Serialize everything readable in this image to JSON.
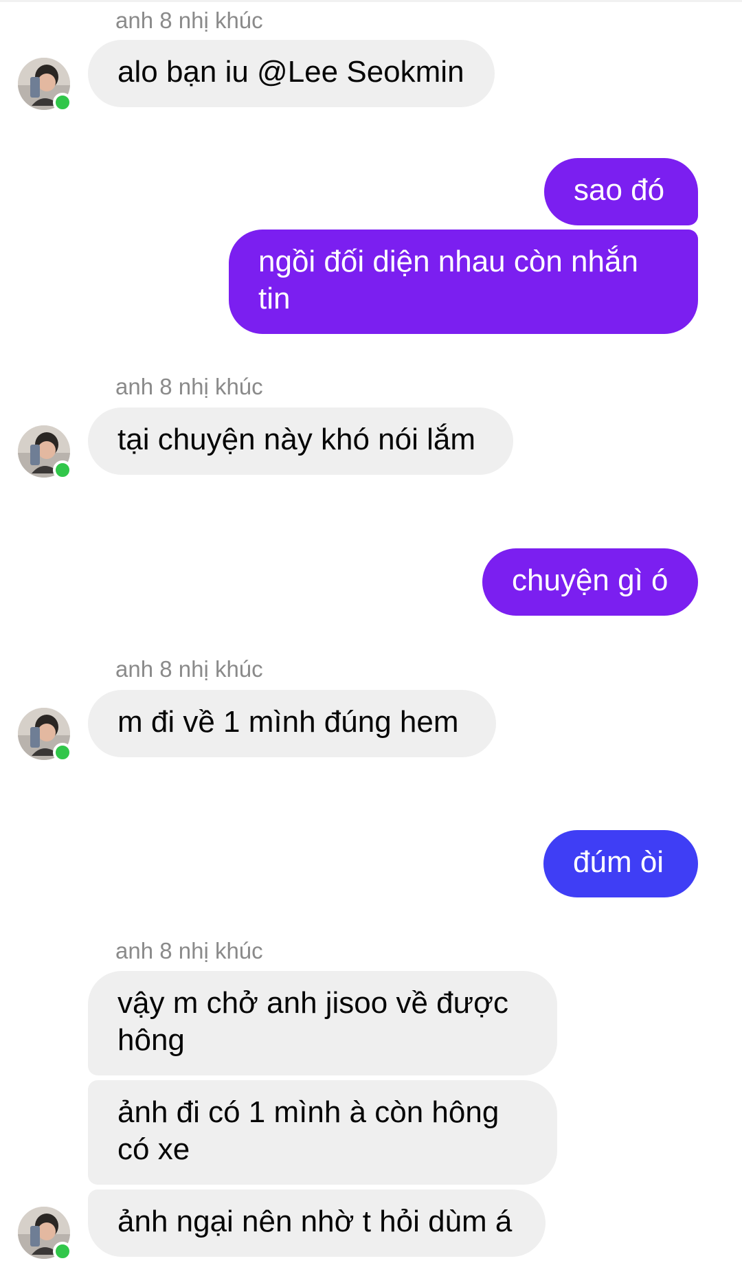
{
  "sender_name": "anh 8 nhị khúc",
  "colors": {
    "incoming_bubble": "#efefef",
    "outgoing_purple": "#7b1ff0",
    "outgoing_blue": "#3f3ef5",
    "online_dot": "#31c64a"
  },
  "messages": [
    {
      "direction": "incoming",
      "text": "alo bạn iu @Lee Seokmin"
    },
    {
      "direction": "outgoing",
      "text": "sao đó"
    },
    {
      "direction": "outgoing",
      "text": "ngồi đối diện nhau còn nhắn tin"
    },
    {
      "direction": "incoming",
      "text": "tại chuyện này khó nói lắm"
    },
    {
      "direction": "outgoing",
      "text": "chuyện gì ó"
    },
    {
      "direction": "incoming",
      "text": "m đi về 1 mình đúng hem"
    },
    {
      "direction": "outgoing",
      "text": "đúm òi"
    },
    {
      "direction": "incoming",
      "text": "vậy m chở anh jisoo về được hông"
    },
    {
      "direction": "incoming",
      "text": "ảnh đi có 1 mình à còn hông có xe"
    },
    {
      "direction": "incoming",
      "text": "ảnh ngại nên nhờ t hỏi dùm á"
    }
  ],
  "avatar_icon": "user-avatar-photo",
  "status_icon": "online-status-dot"
}
